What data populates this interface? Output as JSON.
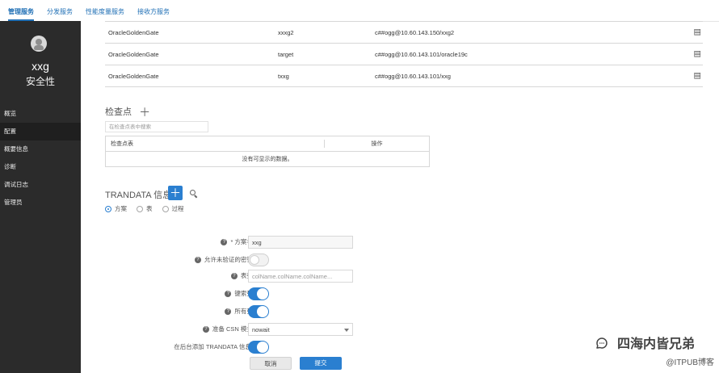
{
  "topTabs": [
    {
      "label": "管理服务",
      "active": true
    },
    {
      "label": "分发服务",
      "active": false
    },
    {
      "label": "性能度量服务",
      "active": false
    },
    {
      "label": "接收方服务",
      "active": false
    }
  ],
  "sidebar": {
    "userName": "xxg",
    "userRole": "安全性",
    "items": [
      {
        "label": "概览",
        "selected": false
      },
      {
        "label": "配置",
        "selected": true
      },
      {
        "label": "概要信息",
        "selected": false
      },
      {
        "label": "诊断",
        "selected": false
      },
      {
        "label": "调试日志",
        "selected": false
      },
      {
        "label": "管理员",
        "selected": false
      }
    ]
  },
  "topTable": {
    "rows": [
      {
        "type": "OracleGoldenGate",
        "alias": "xxxg2",
        "user": "c##ogg@10.60.143.150/xxg2"
      },
      {
        "type": "OracleGoldenGate",
        "alias": "target",
        "user": "c##ogg@10.60.143.101/oracle19c"
      },
      {
        "type": "OracleGoldenGate",
        "alias": "txxg",
        "user": "c##ogg@10.60.143.101/xxg"
      }
    ]
  },
  "checkpoint": {
    "title": "检查点",
    "searchPlaceholder": "在检查点表中搜索",
    "table": {
      "columns": [
        "检查点表",
        "操作"
      ],
      "emptyText": "没有可显示的数据。"
    }
  },
  "trandata": {
    "title": "TRANDATA 信息",
    "radios": [
      {
        "label": "方案",
        "checked": true
      },
      {
        "label": "表",
        "checked": false
      },
      {
        "label": "过程",
        "checked": false
      }
    ],
    "form": {
      "schemaName": {
        "label": "方案名:",
        "value": "xxg"
      },
      "allowUnvalidated": {
        "label": "允许未验证的密钥:",
        "on": false
      },
      "tableColumns": {
        "label": "表列:",
        "placeholder": "colName.colName.colName..."
      },
      "keyColumns": {
        "label": "键索列:",
        "on": true
      },
      "allColumns": {
        "label": "所有列:",
        "on": true
      },
      "prepareCsnMode": {
        "label": "准备 CSN 模式:",
        "value": "nowait"
      },
      "addTrandataInBackground": {
        "label": "在后台添加 TRANDATA 信息?",
        "on": true
      }
    },
    "buttons": {
      "cancel": "取消",
      "submit": "提交"
    }
  },
  "watermark": {
    "brand": "四海内皆兄弟",
    "sub": "@ITPUB博客"
  }
}
